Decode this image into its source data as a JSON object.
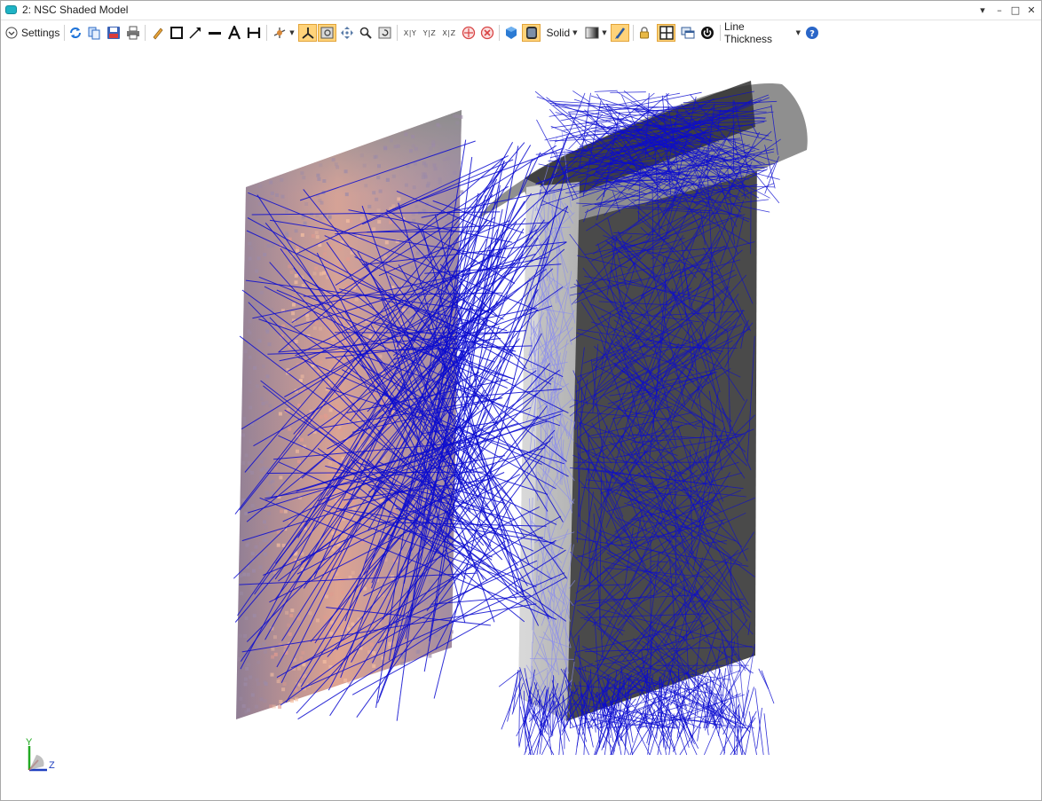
{
  "window": {
    "title": "2: NSC Shaded Model",
    "controls": [
      "▾",
      "–",
      "□",
      "✕"
    ]
  },
  "toolbar": {
    "settings_label": "Settings",
    "axis_views": [
      "X|Y",
      "Y|Z",
      "X|Z"
    ],
    "draw_mode_label": "Solid",
    "line_thickness_label": "Line Thickness"
  },
  "triad": {
    "y_label": "Y",
    "z_label": "Z",
    "y_color": "#22aa22",
    "z_color": "#1f3fc0"
  },
  "colors": {
    "ray_color": "#0b0bd0",
    "highlight": "#ffd37a",
    "detector_glow": "#f3a88a"
  }
}
